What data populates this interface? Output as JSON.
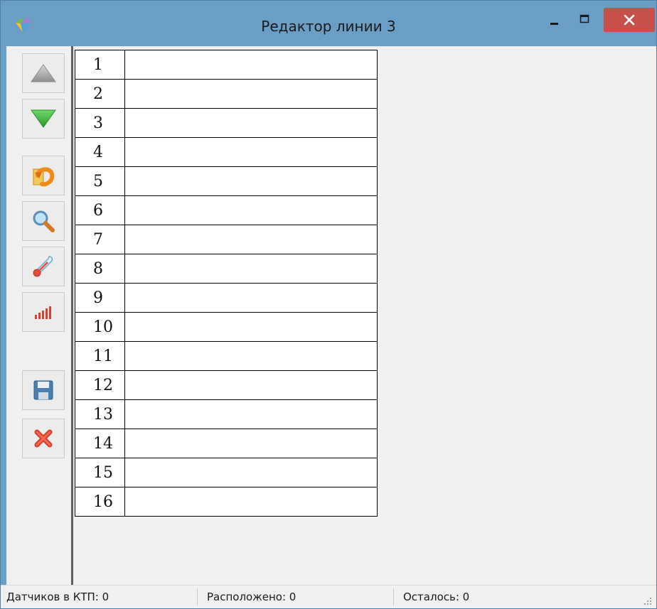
{
  "window": {
    "title": "Редактор линии 3"
  },
  "toolbar": {
    "buttons": [
      {
        "icon": "arrow-up-icon"
      },
      {
        "icon": "arrow-down-icon"
      },
      {
        "icon": "refresh-icon"
      },
      {
        "icon": "search-icon"
      },
      {
        "icon": "thermometer-icon"
      },
      {
        "icon": "signal-bars-icon"
      },
      {
        "icon": "save-icon"
      },
      {
        "icon": "delete-icon"
      }
    ]
  },
  "grid": {
    "rows": [
      {
        "num": "1",
        "value": ""
      },
      {
        "num": "2",
        "value": ""
      },
      {
        "num": "3",
        "value": ""
      },
      {
        "num": "4",
        "value": ""
      },
      {
        "num": "5",
        "value": ""
      },
      {
        "num": "6",
        "value": ""
      },
      {
        "num": "7",
        "value": ""
      },
      {
        "num": "8",
        "value": ""
      },
      {
        "num": "9",
        "value": ""
      },
      {
        "num": "10",
        "value": ""
      },
      {
        "num": "11",
        "value": ""
      },
      {
        "num": "12",
        "value": ""
      },
      {
        "num": "13",
        "value": ""
      },
      {
        "num": "14",
        "value": ""
      },
      {
        "num": "15",
        "value": ""
      },
      {
        "num": "16",
        "value": ""
      }
    ]
  },
  "statusbar": {
    "sensors": "Датчиков в КТП: 0",
    "placed": "Расположено: 0",
    "remaining": "Осталось: 0"
  },
  "colors": {
    "titlebar": "#6b9ec4",
    "close_button": "#c7504b",
    "client_bg": "#f0f0f0"
  }
}
